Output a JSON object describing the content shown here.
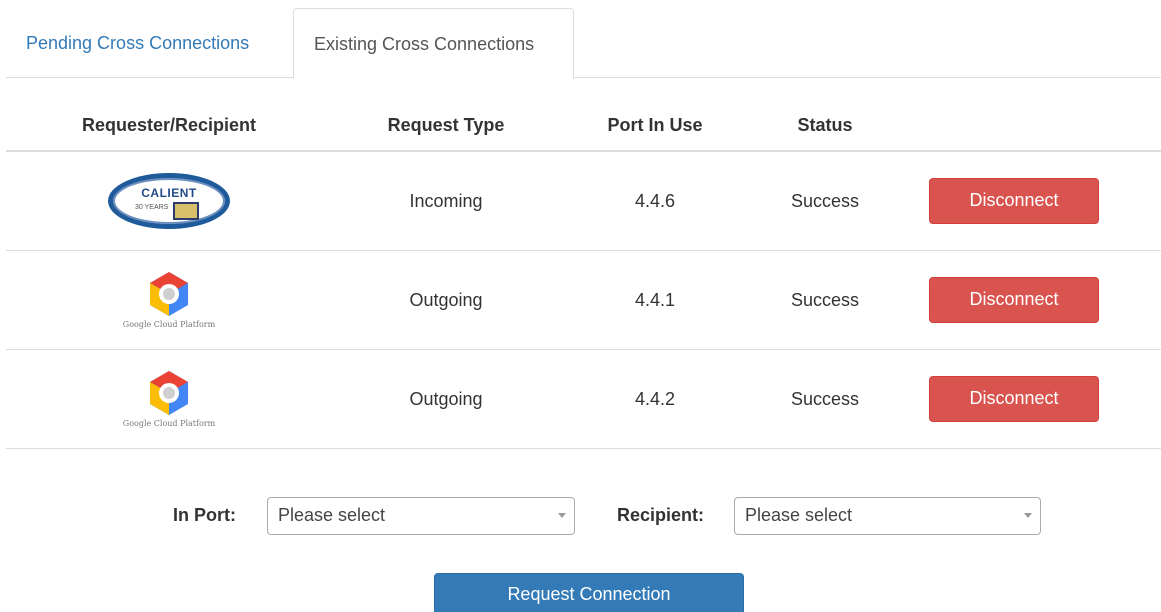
{
  "tabs": [
    {
      "label": "Pending Cross Connections",
      "active": false
    },
    {
      "label": "Existing Cross Connections",
      "active": true
    }
  ],
  "table": {
    "headers": [
      "Requester/Recipient",
      "Request Type",
      "Port In Use",
      "Status"
    ],
    "rows": [
      {
        "logo": "calient-logo",
        "logo_text": "CALIENT",
        "logo_subtext": "30 YEARS",
        "type": "Incoming",
        "port": "4.4.6",
        "status": "Success",
        "action": "Disconnect"
      },
      {
        "logo": "google-cloud-platform-logo",
        "logo_text": "Google Cloud Platform",
        "type": "Outgoing",
        "port": "4.4.1",
        "status": "Success",
        "action": "Disconnect"
      },
      {
        "logo": "google-cloud-platform-logo",
        "logo_text": "Google Cloud Platform",
        "type": "Outgoing",
        "port": "4.4.2",
        "status": "Success",
        "action": "Disconnect"
      }
    ]
  },
  "form": {
    "in_port_label": "In Port:",
    "in_port_value": "Please select",
    "recipient_label": "Recipient:",
    "recipient_value": "Please select",
    "submit_label": "Request Connection"
  },
  "colors": {
    "link": "#337ab7",
    "danger": "#d9534f",
    "primary": "#337ab7"
  }
}
